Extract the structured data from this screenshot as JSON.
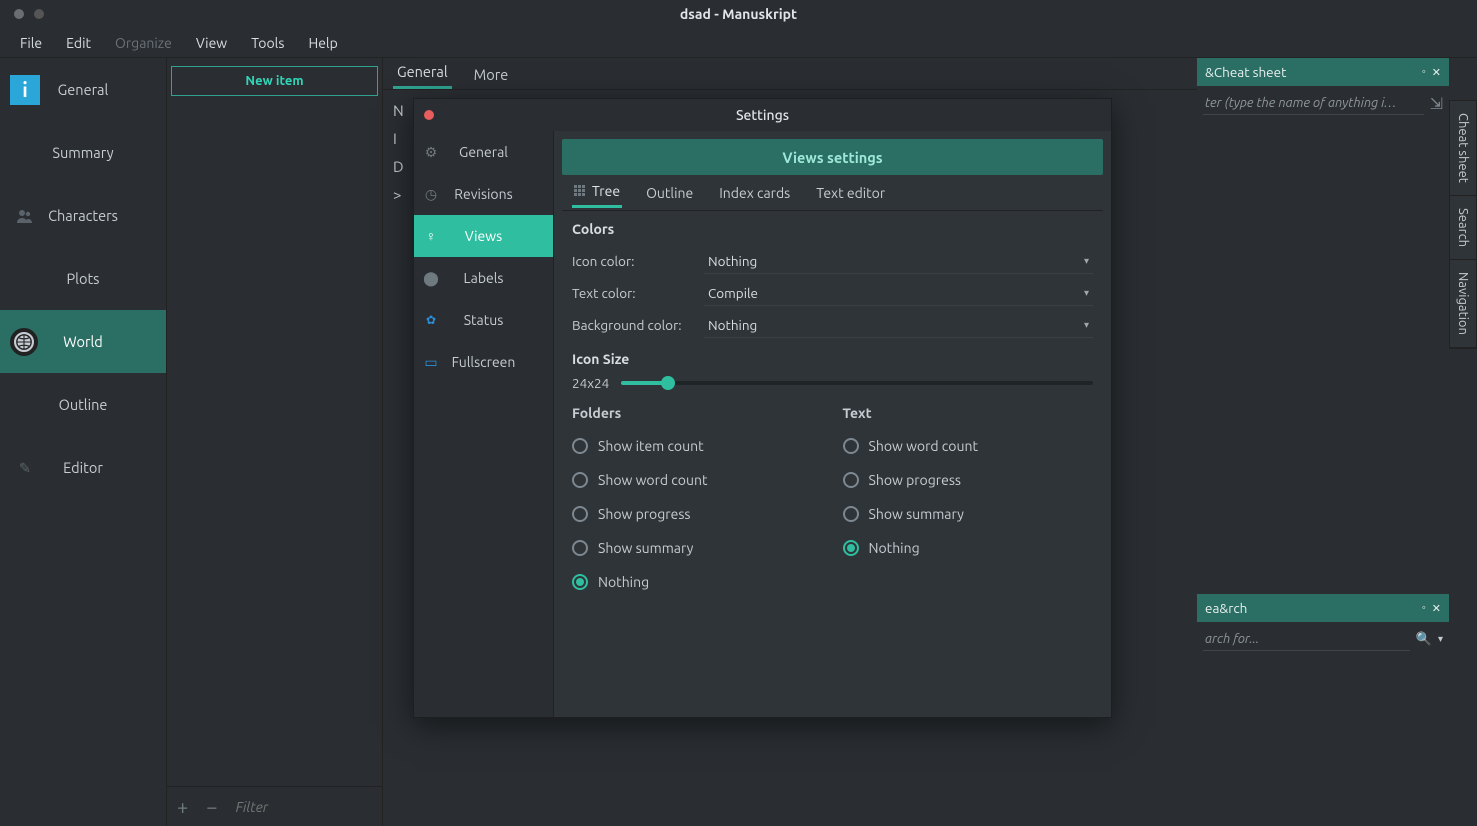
{
  "window": {
    "title": "dsad - Manuskript"
  },
  "menubar": [
    "File",
    "Edit",
    "Organize",
    "View",
    "Tools",
    "Help"
  ],
  "sidenav": {
    "items": [
      "General",
      "Summary",
      "Characters",
      "Plots",
      "World",
      "Outline",
      "Editor"
    ],
    "active": "World"
  },
  "tree": {
    "new_item": "New item",
    "filter_placeholder": "Filter"
  },
  "content_tabs": {
    "tabs": [
      "General",
      "More"
    ],
    "active": "General"
  },
  "content_body": {
    "rows": [
      "N",
      "I",
      "D",
      ">"
    ]
  },
  "cheat_panel": {
    "title": "&Cheat sheet",
    "filter_placeholder": "ter (type the name of anything i…"
  },
  "search_panel": {
    "title": "ea&rch",
    "placeholder": "arch for..."
  },
  "vtabs": [
    "Cheat sheet",
    "Search",
    "Navigation"
  ],
  "settings": {
    "title": "Settings",
    "nav": [
      "General",
      "Revisions",
      "Views",
      "Labels",
      "Status",
      "Fullscreen"
    ],
    "active": "Views",
    "views": {
      "header": "Views settings",
      "tabs": [
        "Tree",
        "Outline",
        "Index cards",
        "Text editor"
      ],
      "active_tab": "Tree",
      "colors": {
        "heading": "Colors",
        "icon_label": "Icon color:",
        "icon_value": "Nothing",
        "text_label": "Text color:",
        "text_value": "Compile",
        "bg_label": "Background color:",
        "bg_value": "Nothing"
      },
      "icon_size": {
        "heading": "Icon Size",
        "value": "24x24",
        "percent": 10
      },
      "folders": {
        "heading": "Folders",
        "options": [
          "Show item count",
          "Show word count",
          "Show progress",
          "Show summary",
          "Nothing"
        ],
        "selected": "Nothing"
      },
      "text": {
        "heading": "Text",
        "options": [
          "Show word count",
          "Show progress",
          "Show summary",
          "Nothing"
        ],
        "selected": "Nothing"
      }
    }
  }
}
